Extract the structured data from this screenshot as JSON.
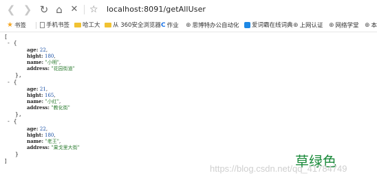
{
  "toolbar": {
    "back_icon": "arrow-left-icon",
    "forward_icon": "arrow-right-icon",
    "reload_icon": "reload-icon",
    "home_icon": "home-icon",
    "stop_icon": "stop-icon",
    "bookmark_icon": "star-outline-icon",
    "url": "localhost:8091/getAllUser"
  },
  "bookmarks": [
    {
      "label": "书签",
      "icon": "star-icon"
    },
    {
      "label": "手机书签",
      "icon": "document-icon"
    },
    {
      "label": "哈工大",
      "icon": "folder-icon"
    },
    {
      "label": "从 360安全浏览器",
      "icon": "folder-icon"
    },
    {
      "label": "作业",
      "icon": "c-icon"
    },
    {
      "label": "思博特办公自动化",
      "icon": "globe-icon"
    },
    {
      "label": "爱词霸在线词典",
      "icon": "app-icon"
    },
    {
      "label": "上网认证",
      "icon": "globe-icon"
    },
    {
      "label": "网络学堂",
      "icon": "globe-icon"
    },
    {
      "label": "本",
      "icon": "globe-icon"
    }
  ],
  "json_view": {
    "open_array": "[",
    "close_array": "]",
    "users": [
      {
        "age": "22",
        "hight": "180",
        "name": "\"小明\"",
        "address": "\"花园街道\""
      },
      {
        "age": "21",
        "hight": "165",
        "name": "\"小红\"",
        "address": "\"教化街\""
      },
      {
        "age": "22",
        "hight": "180",
        "name": "\"老王\"",
        "address": "\"果戈里大街\""
      }
    ],
    "keys": {
      "age": "age: ",
      "hight": "hight: ",
      "name": "name: ",
      "address": "address: "
    }
  },
  "annotation": "草绿色",
  "watermark": "https://blog.csdn.net/qq_41784749",
  "colors": {
    "key": "#222222",
    "number": "#0d47a1",
    "string": "#2e7d32",
    "annotation": "#1b8a3b",
    "watermark": "#cfcfcf"
  }
}
